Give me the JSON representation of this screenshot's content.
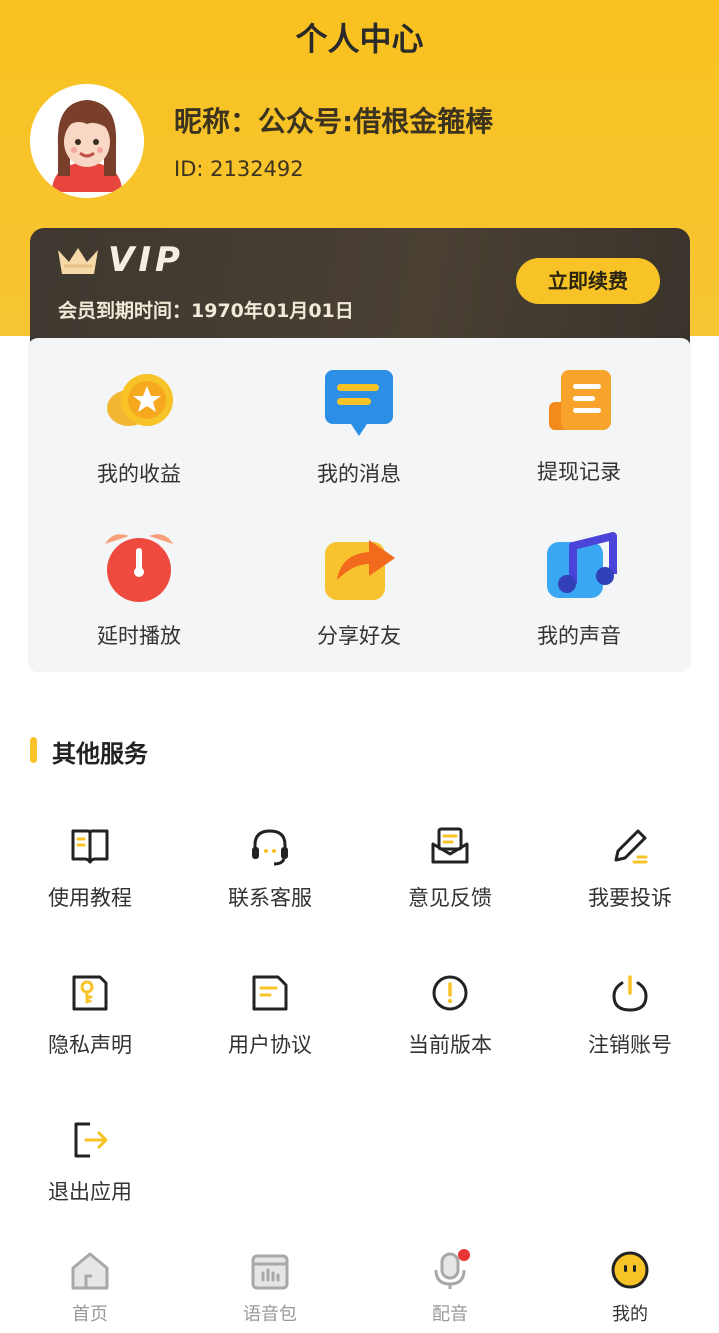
{
  "header": {
    "title": "个人中心"
  },
  "profile": {
    "nickname": "昵称：公众号:借根金箍棒",
    "id": "ID: 2132492"
  },
  "vip": {
    "label": "VIP",
    "expiry": "会员到期时间：1970年01月01日",
    "renew_label": "立即续费"
  },
  "quick_actions": [
    {
      "label": "我的收益",
      "icon": "coin-star-icon"
    },
    {
      "label": "我的消息",
      "icon": "message-bubble-icon"
    },
    {
      "label": "提现记录",
      "icon": "record-list-icon"
    },
    {
      "label": "延时播放",
      "icon": "alarm-clock-icon"
    },
    {
      "label": "分享好友",
      "icon": "share-arrow-icon"
    },
    {
      "label": "我的声音",
      "icon": "music-note-icon"
    }
  ],
  "services": {
    "title": "其他服务",
    "items": [
      {
        "label": "使用教程",
        "icon": "book-icon"
      },
      {
        "label": "联系客服",
        "icon": "headset-icon"
      },
      {
        "label": "意见反馈",
        "icon": "feedback-mail-icon"
      },
      {
        "label": "我要投诉",
        "icon": "pencil-icon"
      },
      {
        "label": "隐私声明",
        "icon": "privacy-key-icon"
      },
      {
        "label": "用户协议",
        "icon": "document-icon"
      },
      {
        "label": "当前版本",
        "icon": "info-exclamation-icon"
      },
      {
        "label": "注销账号",
        "icon": "power-icon"
      },
      {
        "label": "退出应用",
        "icon": "logout-icon"
      }
    ]
  },
  "tabbar": {
    "items": [
      {
        "label": "首页",
        "icon": "home-icon",
        "active": false
      },
      {
        "label": "语音包",
        "icon": "voice-pack-icon",
        "active": false
      },
      {
        "label": "配音",
        "icon": "microphone-icon",
        "active": false,
        "badge": true
      },
      {
        "label": "我的",
        "icon": "smiley-icon",
        "active": true
      }
    ]
  },
  "colors": {
    "accent": "#f8c326",
    "vip_card": "#433a31",
    "panel": "#f4f5f6"
  }
}
